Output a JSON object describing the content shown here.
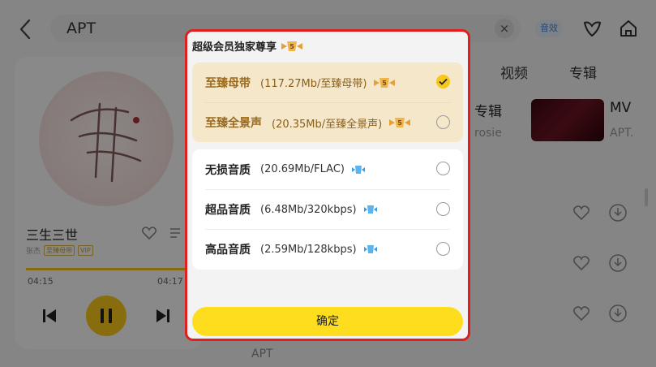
{
  "search": {
    "query": "APT",
    "sound_effect_label": "音效"
  },
  "player": {
    "song_title": "三生三世",
    "artist": "张杰",
    "tags": [
      "至臻母带",
      "VIP"
    ],
    "time_current": "04:15",
    "time_total": "04:17",
    "progress": 0.98
  },
  "background": {
    "tabs": [
      "视频",
      "专辑"
    ],
    "album_title": "专辑",
    "album_sub": "rosie",
    "mv_title": "MV",
    "mv_sub": "APT.",
    "bottom_text": "APT"
  },
  "dialog": {
    "title": "超级会员独家尊享",
    "vip_options": [
      {
        "name": "至臻母带",
        "detail": "(117.27Mb/至臻母带)",
        "checked": true
      },
      {
        "name": "至臻全景声",
        "detail": "(20.35Mb/至臻全景声)",
        "checked": false
      }
    ],
    "std_options": [
      {
        "name": "无损音质",
        "detail": "(20.69Mb/FLAC)",
        "checked": false
      },
      {
        "name": "超品音质",
        "detail": "(6.48Mb/320kbps)",
        "checked": false
      },
      {
        "name": "高品音质",
        "detail": "(2.59Mb/128kbps)",
        "checked": false
      }
    ],
    "confirm_label": "确定"
  },
  "colors": {
    "accent_yellow": "#fddd1e",
    "vip_bg": "#f5e7c9",
    "highlight_border": "#e0201e"
  }
}
